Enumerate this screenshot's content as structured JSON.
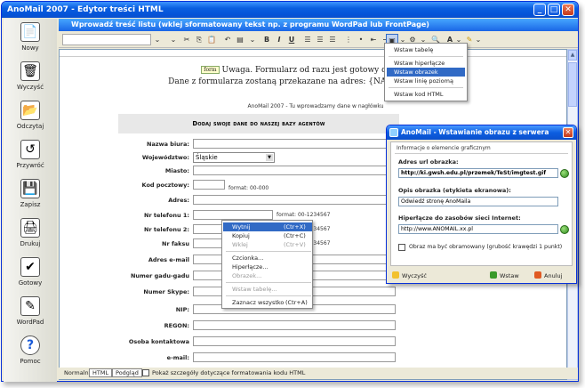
{
  "window": {
    "title": "AnoMail 2007 - Edytor treści HTML"
  },
  "sidebar": {
    "items": [
      {
        "label": "Nowy",
        "icon": "new-document-icon",
        "glyph": "📄"
      },
      {
        "label": "Wyczyść",
        "icon": "trash-icon",
        "glyph": "🗑"
      },
      {
        "label": "Odczytaj",
        "icon": "folder-open-icon",
        "glyph": "📂"
      },
      {
        "label": "Przywróć",
        "icon": "restore-icon",
        "glyph": "↺"
      },
      {
        "label": "Zapisz",
        "icon": "save-icon",
        "glyph": "💾"
      },
      {
        "label": "Drukuj",
        "icon": "printer-icon",
        "glyph": "🖨"
      },
      {
        "label": "Gotowy",
        "icon": "ready-icon",
        "glyph": "✔"
      },
      {
        "label": "WordPad",
        "icon": "wordpad-icon",
        "glyph": "✎"
      },
      {
        "label": "Pomoc",
        "icon": "help-icon",
        "glyph": "?"
      }
    ]
  },
  "editor": {
    "title": "Wprowadź treść listu (wklej sformatowany tekst np. z programu WordPad lub FrontPage)",
    "toolbar": {
      "bold": "B",
      "italic": "I",
      "underline": "U",
      "find": "🔍"
    }
  },
  "document": {
    "form_tag": "form",
    "line1": "Uwaga. Formularz od razu jest gotowy do wysyłki.",
    "line2": "Dane z formularza zostaną przekazane na adres: {NADAWCA#ADRES}",
    "header_note": "AnoMail 2007 - Tu wprowadzamy dane w nagłówku",
    "form_title": "Dodaj swoje dane do naszej bazy agentów",
    "fields": [
      {
        "label": "Nazwa biura:"
      },
      {
        "label": "Województwo:",
        "value": "Śląskie"
      },
      {
        "label": "Miasto:"
      },
      {
        "label": "Kod pocztowy:",
        "hint": "format: 00-000"
      },
      {
        "label": "Adres:"
      },
      {
        "label": "Nr telefonu 1:",
        "hint": "format: 00-1234567"
      },
      {
        "label": "Nr telefonu 2:",
        "hint": "format: 00-1234567"
      },
      {
        "label": "Nr faksu",
        "hint": "format: 00-1234567"
      },
      {
        "label": "Adres e-mail"
      },
      {
        "label": "Numer gadu-gadu"
      },
      {
        "label": "Numer Skype:"
      },
      {
        "label": "NIP:"
      },
      {
        "label": "REGON:"
      },
      {
        "label": "Osoba kontaktowa"
      },
      {
        "label": "e-mail:"
      }
    ]
  },
  "statusbar": {
    "tabs": [
      "Normalny",
      "HTML",
      "Podgląd"
    ],
    "checkbox_label": "Pokaż szczegóły dotyczące formatowania kodu HTML"
  },
  "insert_menu": {
    "items": [
      "Wstaw tabelę",
      "Wstaw hiperłącze",
      "Wstaw obrazek",
      "Wstaw linię poziomą",
      "Wstaw kod HTML"
    ],
    "selected": "Wstaw obrazek"
  },
  "context_menu": {
    "items": [
      {
        "label": "Wytnij",
        "shortcut": "(Ctr+X)"
      },
      {
        "label": "Kopiuj",
        "shortcut": "(Ctr+C)"
      },
      {
        "label": "Wklej",
        "shortcut": "(Ctr+V)"
      },
      {
        "label": "Czcionka..."
      },
      {
        "label": "Hiperłącze..."
      },
      {
        "label": "Obrazek..."
      },
      {
        "label": "Wstaw tabelę..."
      },
      {
        "label": "Zaznacz wszystko",
        "shortcut": "(Ctr+A)"
      }
    ]
  },
  "dialog": {
    "title": "AnoMail - Wstawianie obrazu z serwera",
    "section": "Informacje o elemencie graficznym",
    "url_label": "Adres url obrazka:",
    "url_value": "http://ki.gwsh.edu.pl/przemek/TeSt/imgtest.gif",
    "alt_label": "Opis obrazka (etykieta ekranowa):",
    "alt_value": "Odwiedź stronę AnoMaila",
    "link_label": "Hiperłącze do zasobów sieci Internet:",
    "link_value": "http://www.ANOMAIL.xx.pl",
    "border_label": "Obraz ma być obramowany (grubość krawędzi 1 punkt)",
    "btn_clear": "Wyczyść",
    "btn_insert": "Wstaw",
    "btn_cancel": "Anuluj"
  }
}
